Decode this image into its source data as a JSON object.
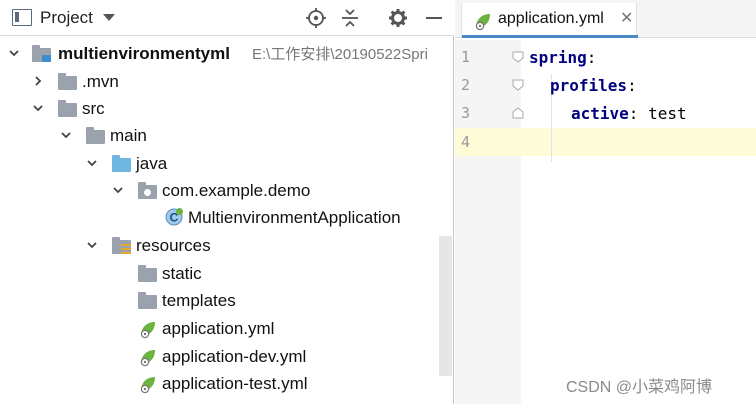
{
  "project_panel": {
    "title": "Project",
    "tools": [
      "locate-icon",
      "collapse-all-icon",
      "gear-icon",
      "minimize-icon"
    ]
  },
  "tree": {
    "root": {
      "name": "multienvironmentyml",
      "path": "E:\\工作安排\\20190522Spri"
    },
    "mvn": ".mvn",
    "src": "src",
    "main": "main",
    "java": "java",
    "package": "com.example.demo",
    "app_class": "MultienvironmentApplication",
    "resources": "resources",
    "static": "static",
    "templates": "templates",
    "file_app": "application.yml",
    "file_dev": "application-dev.yml",
    "file_test": "application-test.yml"
  },
  "editor": {
    "tab_label": "application.yml",
    "tab_close": "✕",
    "line_numbers": [
      "1",
      "2",
      "3",
      "4"
    ],
    "code": {
      "l1_key": "spring",
      "l1_colon": ":",
      "l2_key": "profiles",
      "l2_colon": ":",
      "l3_key": "active",
      "l3_colon": ":",
      "l3_value": " test"
    }
  },
  "watermark": "CSDN @小菜鸡阿博",
  "colors": {
    "accent": "#4a88c7",
    "keyword": "#000080",
    "spring_green": "#6db33f",
    "current_line": "#fdfbd8"
  }
}
